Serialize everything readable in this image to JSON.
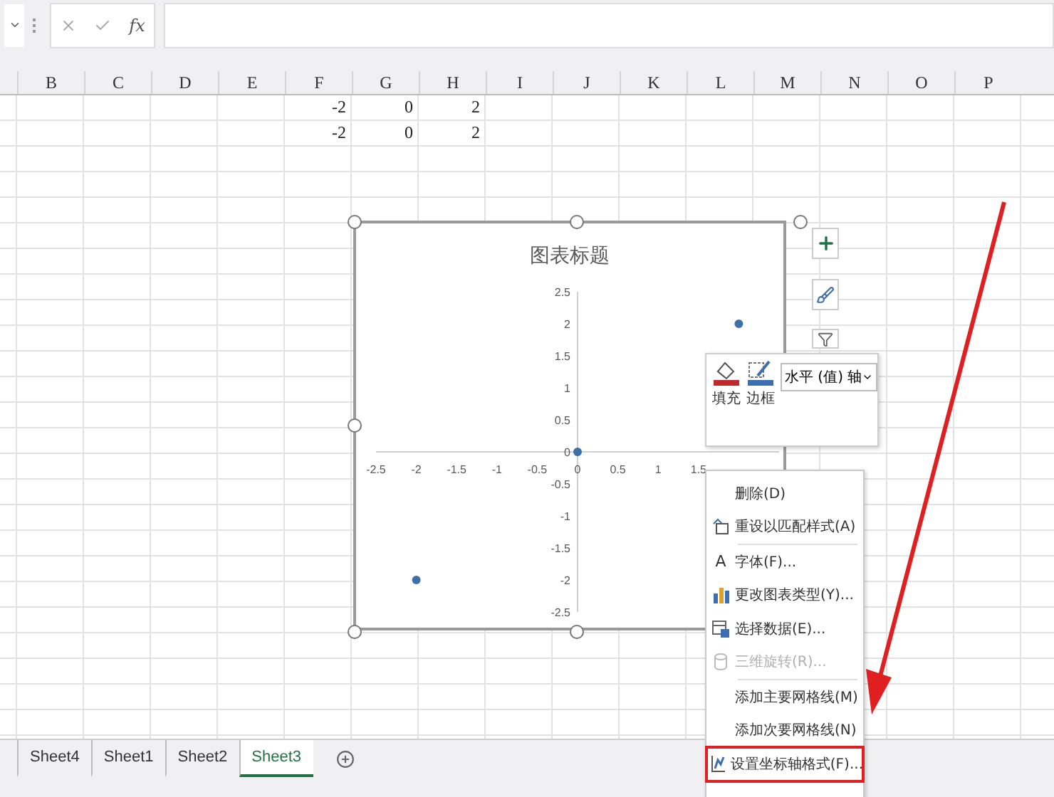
{
  "formula_bar": {
    "function_label": "fx"
  },
  "columns": [
    "B",
    "C",
    "D",
    "E",
    "F",
    "G",
    "H",
    "I",
    "J",
    "K",
    "L",
    "M",
    "N",
    "O",
    "P"
  ],
  "rows": [
    {
      "values": [
        "-2",
        "0",
        "2"
      ]
    },
    {
      "values": [
        "-2",
        "0",
        "2"
      ]
    }
  ],
  "chart": {
    "chart_data": {
      "type": "scatter",
      "title": "图表标题",
      "x": [
        -2,
        0,
        2
      ],
      "series": [
        {
          "color": "#3f6fa8",
          "values": [
            -2,
            0,
            2
          ]
        }
      ],
      "xlim": [
        -2.5,
        2.5
      ],
      "ylim": [
        -2.5,
        2.5
      ],
      "xticks": [
        -2.5,
        -2,
        -1.5,
        -1,
        -0.5,
        0,
        0.5,
        1,
        1.5
      ],
      "yticks": [
        -2.5,
        -2,
        -1.5,
        -1,
        -0.5,
        0,
        0.5,
        1,
        1.5,
        2,
        2.5
      ]
    }
  },
  "mini_toolbar": {
    "fill_label": "填充",
    "border_label": "边框",
    "element_select": "水平 (值) 轴"
  },
  "context_menu": [
    {
      "kind": "item",
      "label": "删除(D)",
      "disabled": false,
      "highlighted": false
    },
    {
      "kind": "item",
      "label": "重设以匹配样式(A)",
      "disabled": false,
      "highlighted": false
    },
    {
      "kind": "separator"
    },
    {
      "kind": "item",
      "glyph": "A",
      "label": "字体(F)...",
      "disabled": false,
      "highlighted": false
    },
    {
      "kind": "item",
      "label": "更改图表类型(Y)...",
      "disabled": false,
      "highlighted": false
    },
    {
      "kind": "item",
      "label": "选择数据(E)...",
      "disabled": false,
      "highlighted": false
    },
    {
      "kind": "item",
      "label": "三维旋转(R)...",
      "disabled": true,
      "highlighted": false
    },
    {
      "kind": "separator"
    },
    {
      "kind": "item",
      "label": "添加主要网格线(M)",
      "disabled": false,
      "highlighted": false
    },
    {
      "kind": "item",
      "label": "添加次要网格线(N)",
      "disabled": false,
      "highlighted": false
    },
    {
      "kind": "item",
      "label": "设置坐标轴格式(F)...",
      "disabled": false,
      "highlighted": true
    }
  ],
  "sheet_tabs": [
    {
      "label": "Sheet4",
      "selected": false
    },
    {
      "label": "Sheet1",
      "selected": false
    },
    {
      "label": "Sheet2",
      "selected": false
    },
    {
      "label": "Sheet3",
      "selected": true
    }
  ]
}
